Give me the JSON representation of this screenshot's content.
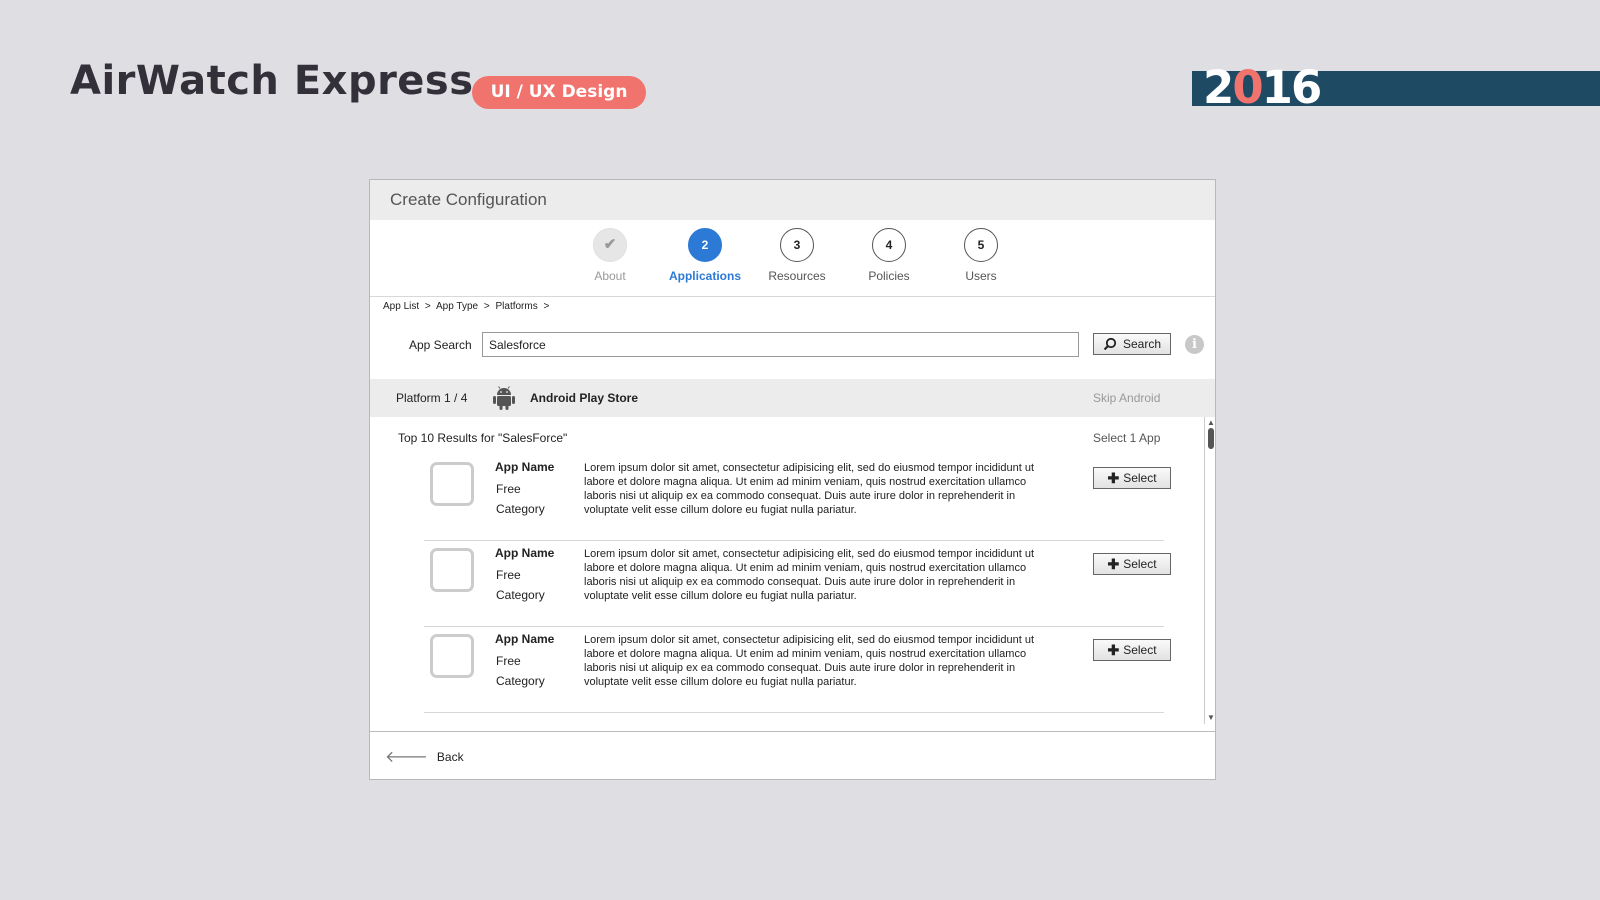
{
  "brand": {
    "title": "AirWatch Express",
    "badge": "UI / UX Design",
    "year_digits": [
      "2",
      "0",
      "1",
      "6"
    ],
    "accent_color": "#f0736e",
    "bar_color": "#1e4a63"
  },
  "window": {
    "title": "Create Configuration",
    "steps": [
      {
        "number": "",
        "label": "About",
        "state": "done",
        "icon": "check-icon"
      },
      {
        "number": "2",
        "label": "Applications",
        "state": "active"
      },
      {
        "number": "3",
        "label": "Resources",
        "state": "pending"
      },
      {
        "number": "4",
        "label": "Policies",
        "state": "pending"
      },
      {
        "number": "5",
        "label": "Users",
        "state": "pending"
      }
    ],
    "breadcrumb": [
      "App List",
      ">",
      "App Type",
      ">",
      "Platforms",
      ">"
    ],
    "search": {
      "label": "App Search",
      "value": "Salesforce",
      "button_label": "Search",
      "button_icon": "search-icon",
      "info_icon": "info-icon"
    },
    "platform": {
      "count": "Platform 1 / 4",
      "name": "Android Play Store",
      "icon": "android-icon",
      "skip": "Skip Android"
    },
    "results": {
      "title": "Top 10 Results for \"SalesForce\"",
      "select_count": "Select 1 App",
      "items": [
        {
          "name": "App Name",
          "price": "Free",
          "category": "Category",
          "description": "Lorem ipsum dolor sit amet, consectetur adipisicing elit, sed do eiusmod tempor incididunt ut labore et dolore magna aliqua. Ut enim ad minim veniam, quis nostrud exercitation ullamco laboris nisi ut aliquip ex ea commodo consequat. Duis aute irure dolor in reprehenderit in voluptate velit esse cillum dolore eu fugiat nulla pariatur.",
          "button": "Select"
        },
        {
          "name": "App Name",
          "price": "Free",
          "category": "Category",
          "description": "Lorem ipsum dolor sit amet, consectetur adipisicing elit, sed do eiusmod tempor incididunt ut labore et dolore magna aliqua. Ut enim ad minim veniam, quis nostrud exercitation ullamco laboris nisi ut aliquip ex ea commodo consequat. Duis aute irure dolor in reprehenderit in voluptate velit esse cillum dolore eu fugiat nulla pariatur.",
          "button": "Select"
        },
        {
          "name": "App Name",
          "price": "Free",
          "category": "Category",
          "description": "Lorem ipsum dolor sit amet, consectetur adipisicing elit, sed do eiusmod tempor incididunt ut labore et dolore magna aliqua. Ut enim ad minim veniam, quis nostrud exercitation ullamco laboris nisi ut aliquip ex ea commodo consequat. Duis aute irure dolor in reprehenderit in voluptate velit esse cillum dolore eu fugiat nulla pariatur.",
          "button": "Select"
        }
      ]
    },
    "back_label": "Back"
  }
}
